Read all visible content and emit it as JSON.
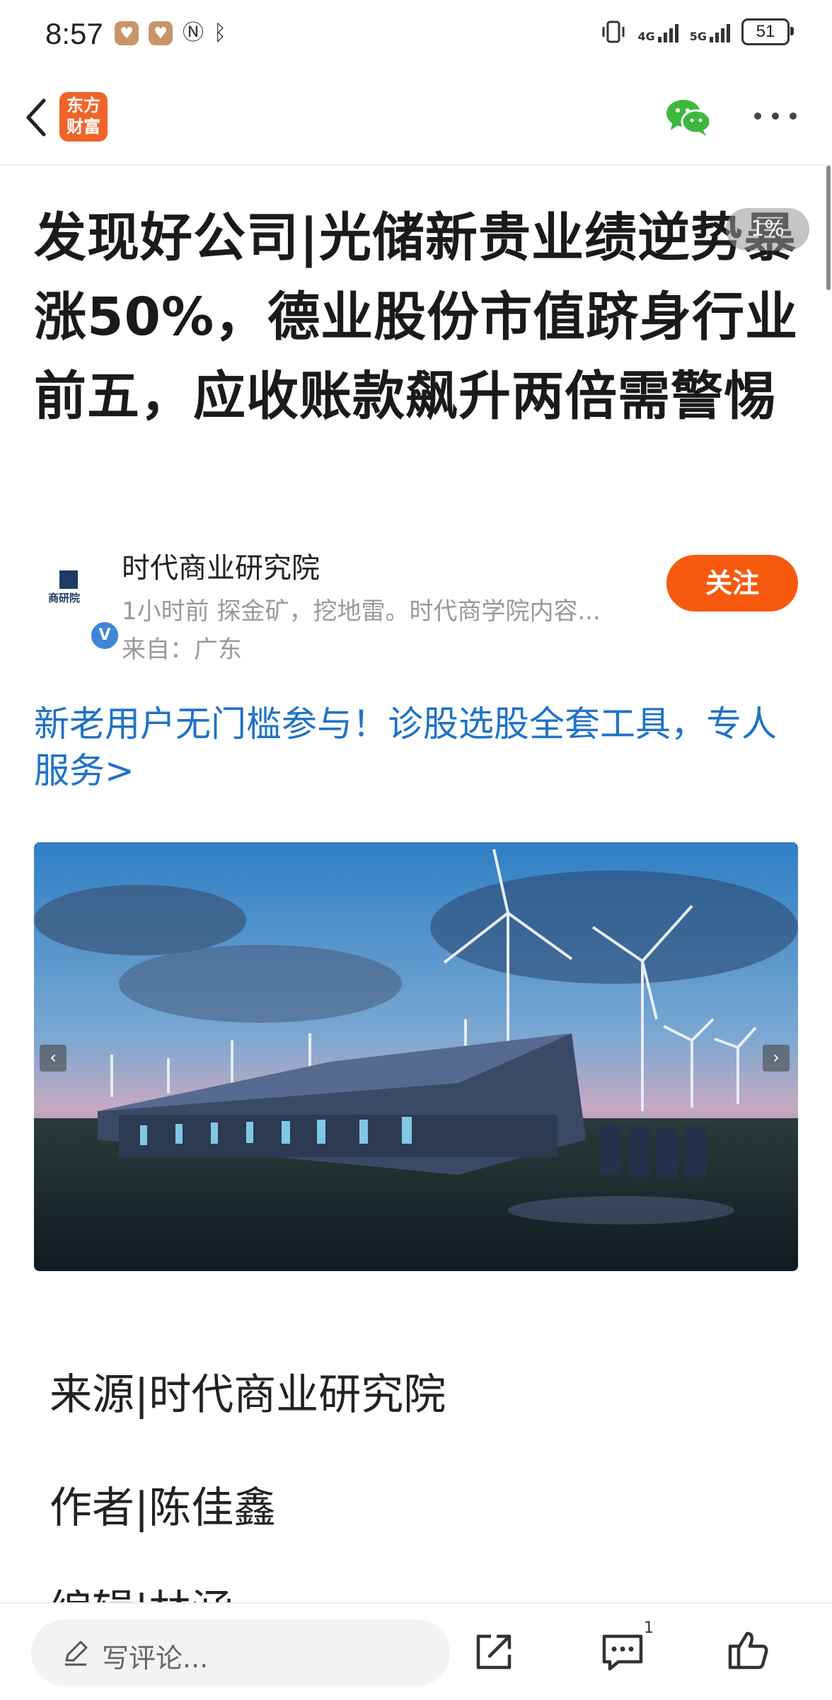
{
  "status_bar": {
    "time": "8:57",
    "battery": "51",
    "net1": "4G",
    "net2": "5G"
  },
  "nav": {
    "logo_line1": "东方",
    "logo_line2": "财富",
    "accent": "#f0642a"
  },
  "article": {
    "title": "发现好公司|光储新贵业绩逆势暴涨50%，德业股份市值跻身行业前五，应收账款飙升两倍需警惕",
    "zoom_badge": "1%",
    "author_name": "时代商业研究院",
    "author_avatar_text": "商研院",
    "verified_badge": "V",
    "author_meta": "1小时前  探金矿，挖地雷。时代商学院内容...",
    "author_location": "来自：广东",
    "follow_label": "关注",
    "promo_text": "新老用户无门槛参与！诊股选股全套工具，专人服务>",
    "source_line": "来源|时代商业研究院",
    "author_line": "作者|陈佳鑫",
    "partial_line": "编辑|林涵"
  },
  "bottom_bar": {
    "comment_placeholder": "写评论...",
    "comment_count": "1"
  },
  "icons": {
    "back": "chevron-left-icon",
    "wechat": "wechat-icon",
    "more": "more-dots-icon",
    "pencil": "pencil-icon",
    "share": "share-icon",
    "comment": "comment-icon",
    "like": "thumbs-up-icon"
  },
  "colors": {
    "follow": "#f75a0f",
    "link": "#1f72c7",
    "verified": "#3f86d9"
  }
}
